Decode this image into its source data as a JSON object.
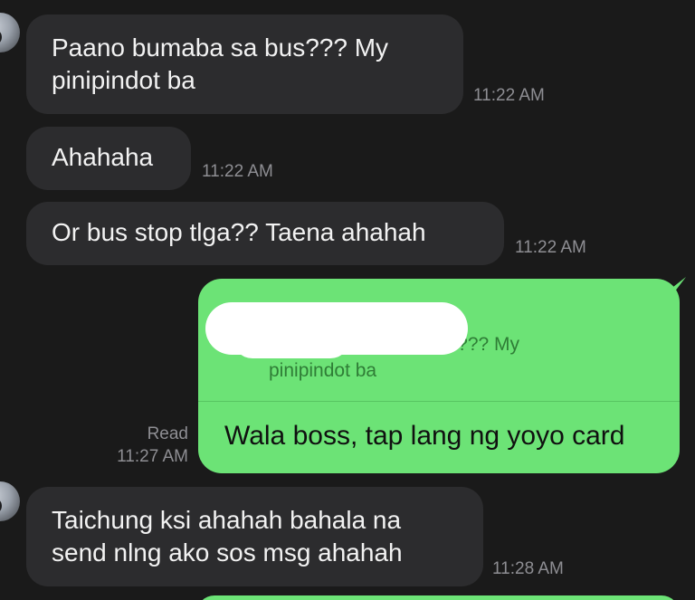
{
  "messages_in": [
    {
      "lines": [
        "Paano bumaba sa bus??? My",
        "pinipindot ba"
      ],
      "time": "11:22 AM"
    },
    {
      "lines": [
        "Ahahaha"
      ],
      "time": "11:22 AM"
    },
    {
      "lines": [
        "Or bus stop tlga?? Taena ahahah"
      ],
      "time": "11:22 AM"
    },
    {
      "lines": [
        "Taichung ksi ahahah bahala na",
        "send nlng ako sos msg ahahah"
      ],
      "time": "11:28 AM"
    }
  ],
  "message_out": {
    "reply_quote_lines": [
      "aano bumaba sa bus??? My",
      "pinipindot ba"
    ],
    "text": "Wala boss, tap lang ng yoyo card",
    "status_label": "Read",
    "status_time": "11:27 AM"
  },
  "colors": {
    "background": "#1a1a1a",
    "incoming_bubble": "#2c2c2e",
    "outgoing_bubble": "#6ce376",
    "timestamp": "#8e8e93"
  }
}
